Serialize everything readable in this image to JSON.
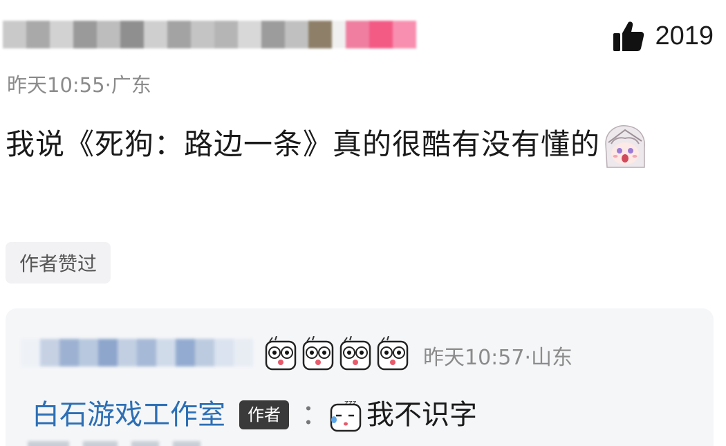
{
  "comment": {
    "username_redacted": "",
    "likes": "2019",
    "meta": "昨天10:55·广东",
    "text_prefix": "我说《死狗：路边一条》真的很酷有没有懂的",
    "author_liked_badge": "作者赞过"
  },
  "reply": {
    "username_redacted": "",
    "meta": "昨天10:57·山东",
    "author": "白石游戏工作室",
    "author_tag": "作者",
    "colon": "：",
    "text": "我不识字"
  },
  "colors": {
    "link": "#2d6fb5",
    "meta": "#8b8b8b",
    "reply_bg": "#f5f6f8",
    "badge_bg": "#f2f2f4"
  },
  "icons": {
    "like": "thumbs-up-icon",
    "sticker_anime": "anime-girl-sticker",
    "face": "wide-eyed-face-emoji",
    "sleep": "sleeping-face-emoji"
  }
}
